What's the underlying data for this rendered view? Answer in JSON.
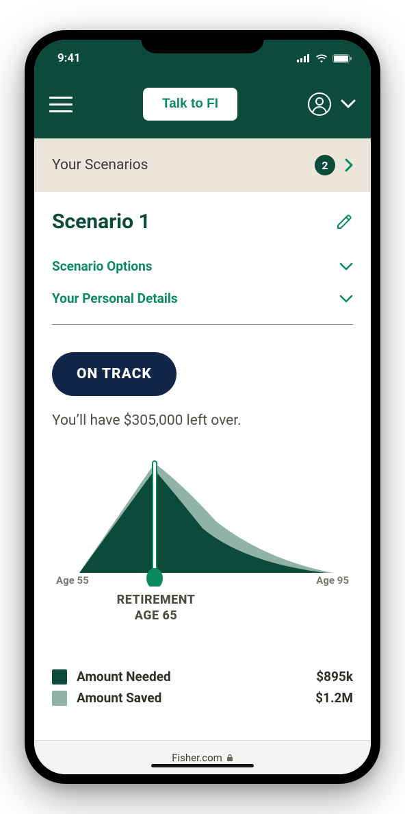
{
  "status_bar": {
    "time": "9:41"
  },
  "header": {
    "talk_btn": "Talk to FI"
  },
  "scenarios_bar": {
    "label": "Your Scenarios",
    "count": "2"
  },
  "scenario": {
    "title": "Scenario 1",
    "options_label": "Scenario Options",
    "details_label": "Your Personal Details"
  },
  "status_pill": "ON TRACK",
  "summary": "You’ll have $305,000 left over.",
  "chart_data": {
    "type": "area",
    "x_range": [
      55,
      95
    ],
    "retirement_age": 65,
    "axis_left": "Age 55",
    "axis_right": "Age 95",
    "retire_line1": "RETIREMENT",
    "retire_line2": "AGE 65",
    "series": [
      {
        "name": "Amount Saved",
        "color": "#8fb3a6",
        "peak_age": 65
      },
      {
        "name": "Amount Needed",
        "color": "#0c4a3a",
        "peak_age": 65
      }
    ]
  },
  "legend": {
    "needed_label": "Amount Needed",
    "needed_value": "$895k",
    "saved_label": "Amount Saved",
    "saved_value": "$1.2M"
  },
  "colors": {
    "dark_green": "#0c4a3a",
    "light_green": "#8fb3a6",
    "accent": "#0c8a5f"
  },
  "browser": {
    "domain": "Fisher.com"
  }
}
